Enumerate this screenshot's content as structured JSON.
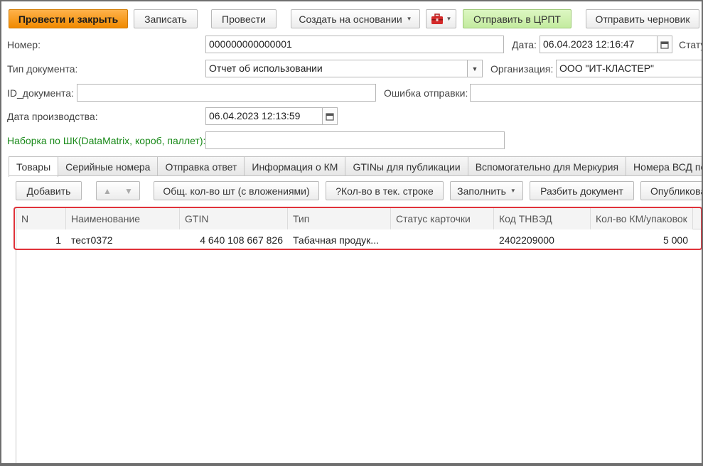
{
  "toolbar": {
    "post_close": "Провести и закрыть",
    "save": "Записать",
    "post": "Провести",
    "create_based": "Создать на основании",
    "send_crpt": "Отправить в ЦРПТ",
    "send_draft": "Отправить черновик"
  },
  "form": {
    "number_label": "Номер:",
    "number_value": "000000000000001",
    "date_label": "Дата:",
    "date_value": "06.04.2023 12:16:47",
    "status_label": "Статус:",
    "doc_type_label": "Тип документа:",
    "doc_type_value": "Отчет об использовании",
    "org_label": "Организация:",
    "org_value": "ООО \"ИТ-КЛАСТЕР\"",
    "doc_id_label": "ID_документа:",
    "doc_id_value": "",
    "send_error_label": "Ошибка отправки:",
    "send_error_value": "",
    "prod_date_label": "Дата производства:",
    "prod_date_value": "06.04.2023 12:13:59",
    "barcode_label": "Наборка по ШК(DataMatrix, короб, паллет):",
    "barcode_value": ""
  },
  "tabs": [
    "Товары",
    "Серийные номера",
    "Отправка ответ",
    "Информация о КМ",
    "GTINы для публикации",
    "Вспомогательно для Меркурия",
    "Номера ВСД по Аналитике"
  ],
  "table_toolbar": {
    "add": "Добавить",
    "total_qty": "Общ. кол-во шт (с вложениями)",
    "qty_row": "?Кол-во в тек. строке",
    "fill": "Заполнить",
    "split": "Разбить документ",
    "publish": "Опубликовать"
  },
  "table": {
    "columns": [
      "N",
      "Наименование",
      "GTIN",
      "Тип",
      "Статус карточки",
      "Код ТНВЭД",
      "Кол-во КМ/упаковок"
    ],
    "rows": [
      {
        "n": "1",
        "name": "тест0372",
        "gtin": "4 640 108 667 826",
        "type": "Табачная продук...",
        "status": "",
        "tnved": "2402209000",
        "qty": "5 000"
      }
    ]
  },
  "icons": {
    "briefcase": "briefcase-icon",
    "calendar": "calendar-icon",
    "arrow_up": "arrow-up-icon",
    "arrow_down": "arrow-down-icon"
  },
  "colors": {
    "primary_button": "#f39a1e",
    "send_button": "#c3eb9f",
    "highlight": "#e0323a",
    "barcode_label": "#1a8a1a"
  }
}
